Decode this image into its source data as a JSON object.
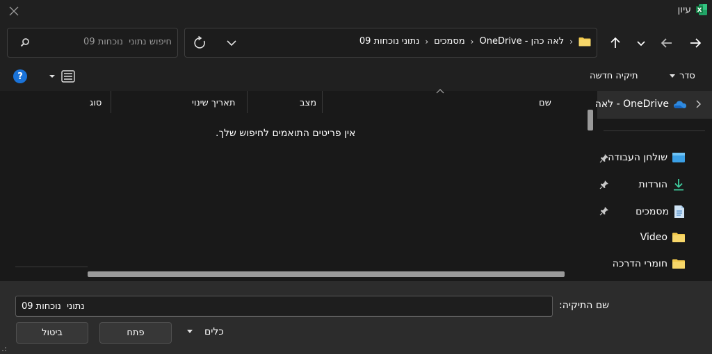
{
  "window": {
    "title": "עיון",
    "app_icon": "excel-icon",
    "close_icon": "close-icon"
  },
  "search": {
    "placeholder": "חיפוש נתוני  נוכחות 09"
  },
  "breadcrumb": {
    "items": [
      "OneDrive - לאה כהן",
      "מסמכים",
      "נתוני  נוכחות 09"
    ],
    "separator": "›"
  },
  "toolbar": {
    "organize_label": "סדר",
    "new_folder_label": "תיקיה חדשה",
    "help_label": "?"
  },
  "columns": {
    "name": "שם",
    "status": "מצב",
    "modified": "תאריך שינוי",
    "type": "סוג"
  },
  "file_list": {
    "empty_message": "אין פריטים התואמים לחיפוש שלך."
  },
  "nav_pane": {
    "onedrive_label": "OneDrive - לאה",
    "items": [
      {
        "label": "שולחן העבודה",
        "icon": "desktop-icon",
        "pinned": true
      },
      {
        "label": "הורדות",
        "icon": "download-icon",
        "pinned": true
      },
      {
        "label": "מסמכים",
        "icon": "documents-icon",
        "pinned": true
      },
      {
        "label": "Video",
        "icon": "folder-icon",
        "pinned": false
      },
      {
        "label": "חומרי הדרכה",
        "icon": "folder-icon",
        "pinned": false
      }
    ]
  },
  "footer": {
    "folder_label": "שם התיקיה:",
    "folder_value": "נתוני  נוכחות 09",
    "tools_label": "כלים",
    "open_label": "פתח",
    "cancel_label": "ביטול"
  },
  "colors": {
    "background": "#202020",
    "list_background": "#191919",
    "footer_background": "#2c2c2c",
    "accent_blue": "#1a73d9",
    "folder_yellow": "#f2c94c",
    "excel_green": "#1e7145"
  }
}
